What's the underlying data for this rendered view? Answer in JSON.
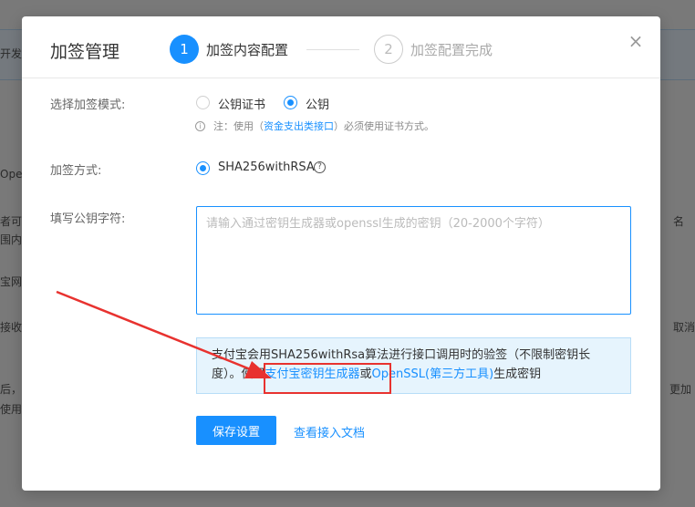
{
  "background": {
    "fragments": [
      "开发",
      "Open",
      "者可",
      "围内",
      "宝网",
      "接收",
      "后，",
      "使用",
      "名",
      "取消",
      "更加"
    ]
  },
  "modal": {
    "title": "加签管理",
    "close_symbol": "×",
    "steps": [
      {
        "number": "1",
        "label": "加签内容配置"
      },
      {
        "number": "2",
        "label": "加签配置完成"
      }
    ]
  },
  "form": {
    "mode_label": "选择加签模式:",
    "mode_options": [
      {
        "label": "公钥证书",
        "checked": false
      },
      {
        "label": "公钥",
        "checked": true
      }
    ],
    "note_prefix": "注：使用（",
    "note_link": "资金支出类接口",
    "note_suffix": "）必须使用证书方式。",
    "method_label": "加签方式:",
    "method_option": "SHA256withRSA",
    "help_symbol": "?",
    "key_label": "填写公钥字符:",
    "key_placeholder": "请输入通过密钥生成器或openssl生成的密钥（20-2000个字符）",
    "key_value": ""
  },
  "info": {
    "text_1": "支付宝会用SHA256withRsa算法进行接口调用时的验签（不限制密钥长度）。使用",
    "link_1": "支付宝密钥生成器",
    "text_2": "或",
    "link_2": "OpenSSL(第三方工具)",
    "text_3": "生成密钥"
  },
  "actions": {
    "save_label": "保存设置",
    "doc_link": "查看接入文档"
  },
  "colors": {
    "primary": "#1890ff",
    "annotation": "#e8322f"
  }
}
